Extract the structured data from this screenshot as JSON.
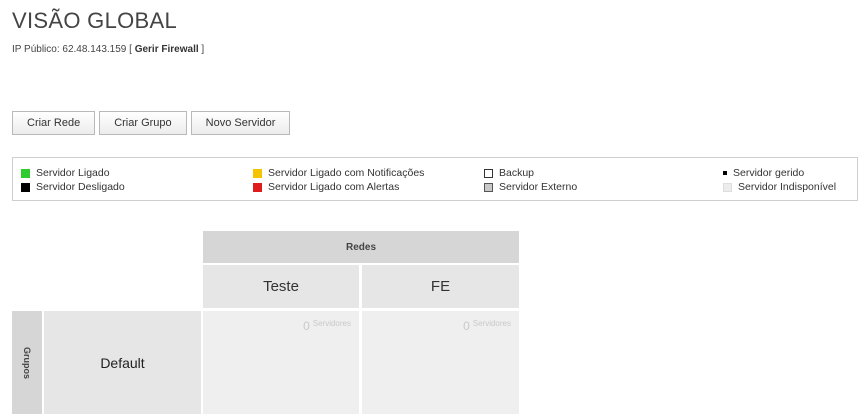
{
  "header": {
    "title": "VISÃO GLOBAL",
    "ip_label": "IP Público: 62.48.143.159 [",
    "manage_firewall": "Gerir Firewall",
    "ip_suffix": "]"
  },
  "toolbar": {
    "create_network": "Criar Rede",
    "create_group": "Criar Grupo",
    "new_server": "Novo Servidor"
  },
  "legend": {
    "items": [
      {
        "label": "Servidor Ligado",
        "color": "#2ecc2e"
      },
      {
        "label": "Servidor Desligado",
        "color": "#000000"
      },
      {
        "label": "Servidor Ligado com Notificações",
        "color": "#f5c400"
      },
      {
        "label": "Servidor Ligado com Alertas",
        "color": "#e01b1b"
      },
      {
        "label": "Backup",
        "color": "#ffffff"
      },
      {
        "label": "Servidor Externo",
        "color": "#c8c8c8"
      },
      {
        "label": "Servidor gerido",
        "color": "#000000"
      },
      {
        "label": "Servidor Indisponível",
        "color": "#ececec"
      }
    ]
  },
  "grid": {
    "networks_label": "Redes",
    "groups_label": "Grupos",
    "networks": [
      "Teste",
      "FE"
    ],
    "groups": [
      {
        "name": "Default",
        "cells": [
          {
            "count": "0",
            "unit": "Servidores"
          },
          {
            "count": "0",
            "unit": "Servidores"
          }
        ]
      }
    ]
  }
}
